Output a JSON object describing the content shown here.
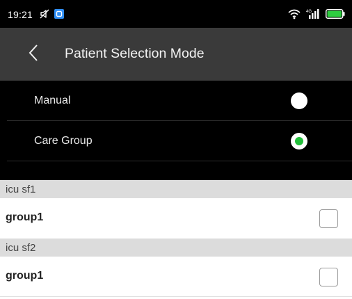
{
  "status_bar": {
    "time": "19:21",
    "left_icons": [
      "mute-icon",
      "app-notification-icon"
    ],
    "right_icons": [
      "wifi-icon",
      "signal-4g-icon",
      "battery-icon"
    ],
    "signal_label": "4G",
    "battery_color": "#2ecc40"
  },
  "header": {
    "back_icon": "chevron-left-icon",
    "title": "Patient Selection Mode"
  },
  "modes": [
    {
      "label": "Manual",
      "selected": false
    },
    {
      "label": "Care Group",
      "selected": true
    }
  ],
  "groups": [
    {
      "header": "icu sf1",
      "items": [
        {
          "label": "group1",
          "checked": false
        }
      ]
    },
    {
      "header": "icu sf2",
      "items": [
        {
          "label": "group1",
          "checked": false
        }
      ]
    }
  ],
  "colors": {
    "accent": "#22bf3a",
    "header_bg": "#3a3a3a",
    "list_bg": "#000000",
    "section_header_bg": "#dcdcdc"
  }
}
